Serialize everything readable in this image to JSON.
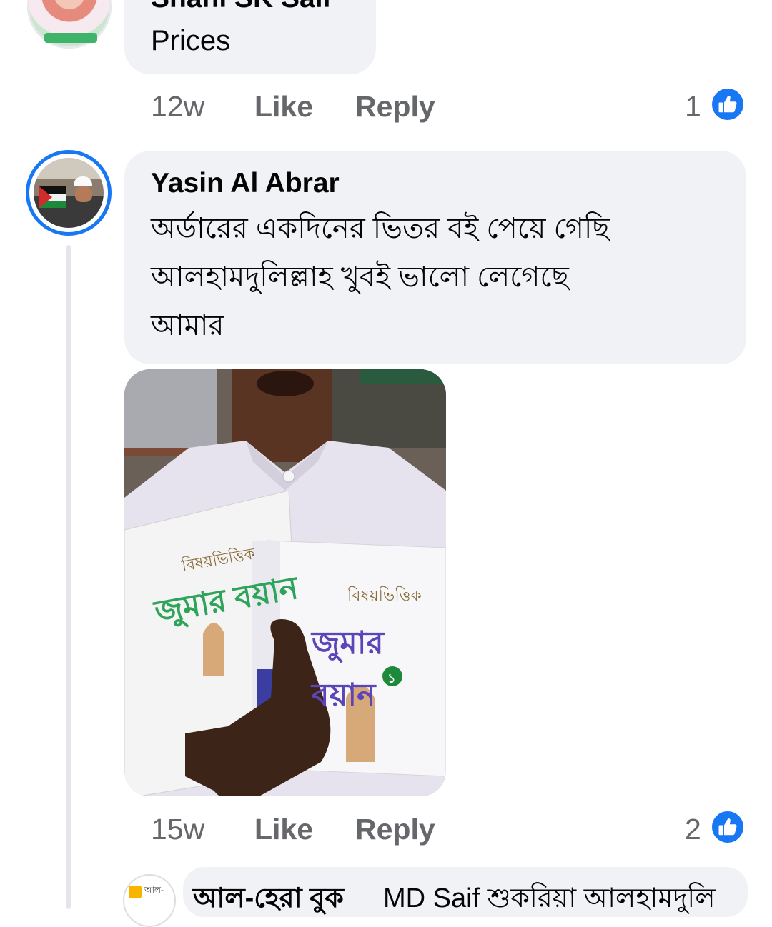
{
  "comments": [
    {
      "author": "Shahi SK Sali",
      "text": "Prices",
      "time": "12w",
      "like_label": "Like",
      "reply_label": "Reply",
      "reaction_count": "1",
      "reaction_icon": "thumbs-up-icon"
    },
    {
      "author": "Yasin Al Abrar",
      "text_lines": [
        "অর্ডারের একদিনের ভিতর বই পেয়ে গেছি",
        "আলহামদুলিল্লাহ খুবই ভালো লেগেছে",
        "আমার"
      ],
      "time": "15w",
      "like_label": "Like",
      "reply_label": "Reply",
      "reaction_count": "2",
      "reaction_icon": "thumbs-up-icon",
      "photo": {
        "book_title_small": "বিষয়ভিত্তিক",
        "book_title_big": "জুমার বয়ান",
        "book_volume": "১"
      }
    }
  ],
  "reply_preview": {
    "author": "আল-হেরা বুক",
    "text": "MD Saif শুকরিয়া আলহামদুলি",
    "avatar_text": "আল-"
  },
  "colors": {
    "bubble": "#f0f2f5",
    "meta_text": "#65676b",
    "like_blue": "#1877f2",
    "thread_line": "#e4e6eb"
  }
}
